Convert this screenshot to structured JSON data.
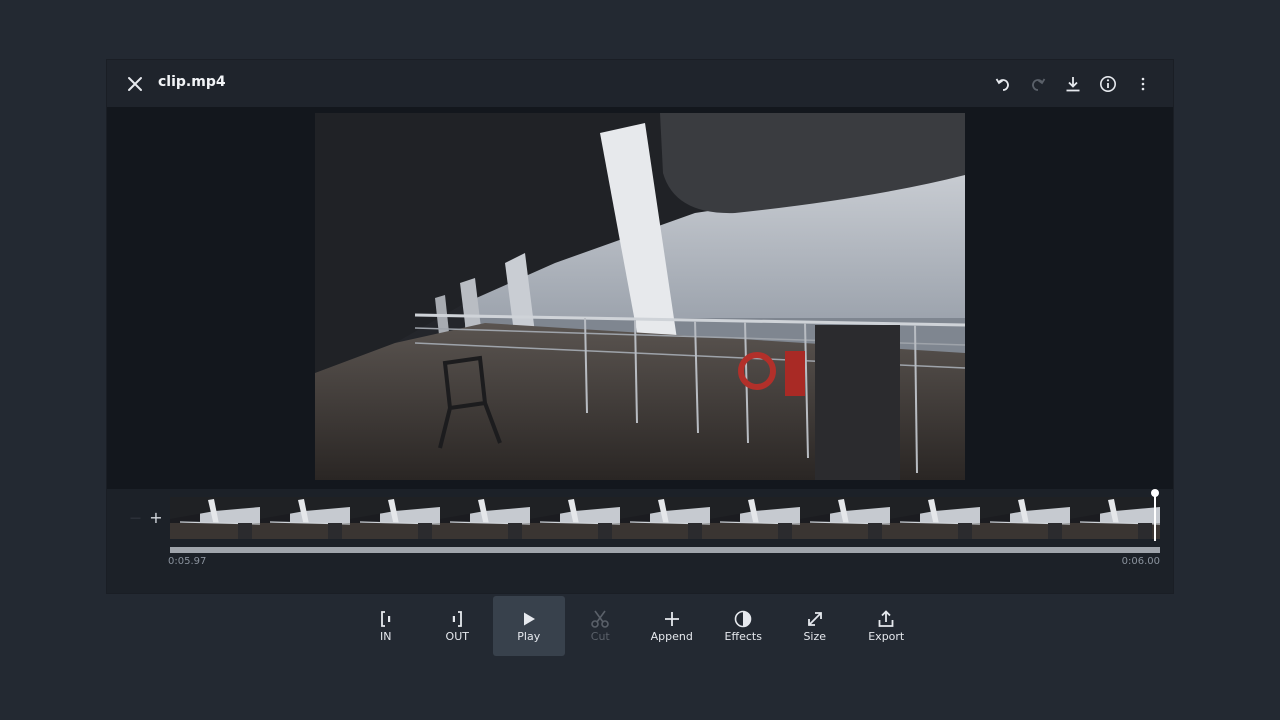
{
  "window": {
    "title": "clip.mp4"
  },
  "titlebar_icons": [
    "undo-icon",
    "redo-icon",
    "download-icon",
    "info-icon",
    "more-vert-icon"
  ],
  "timeline": {
    "add_label": "+",
    "time_start": "0:05.97",
    "time_end": "0:06.00",
    "playhead_progress": 1.0,
    "thumbnail_count": 11
  },
  "toolbar": {
    "in": "IN",
    "out": "OUT",
    "play": "Play",
    "cut": "Cut",
    "append": "Append",
    "effects": "Effects",
    "size": "Size",
    "export": "Export"
  },
  "colors": {
    "background": "#232932",
    "active_tool": "#38414c",
    "disabled": "#5a6069"
  }
}
